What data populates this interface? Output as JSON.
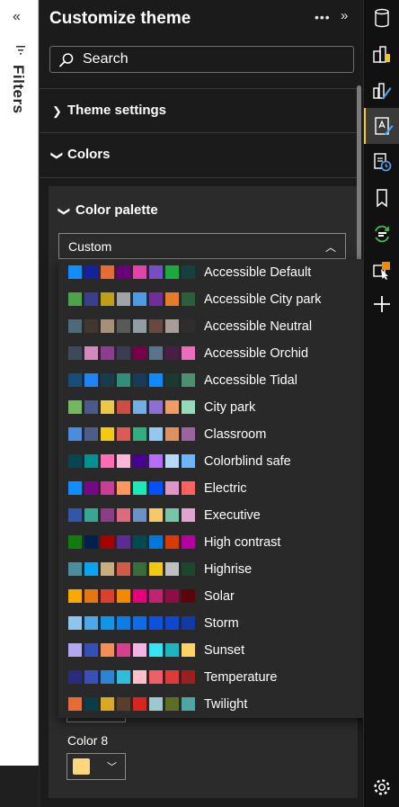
{
  "filters": {
    "label": "Filters"
  },
  "pane": {
    "title": "Customize theme",
    "search_placeholder": "Search",
    "sections": [
      "Theme settings",
      "Colors"
    ],
    "palette_title": "Color palette",
    "dropdown_value": "Custom",
    "color8_label": "Color 8",
    "color8_value": "#fdd77b"
  },
  "palette_options": [
    {
      "name": "Accessible Default",
      "colors": [
        "#118dff",
        "#12239e",
        "#e66c37",
        "#6b007b",
        "#e044a7",
        "#744ec2",
        "#1aab40",
        "#15403e"
      ]
    },
    {
      "name": "Accessible City park",
      "colors": [
        "#4da34b",
        "#393f8a",
        "#c09e16",
        "#a0a3a8",
        "#4e9ae3",
        "#6e2f98",
        "#e57c27",
        "#2c5e3a"
      ]
    },
    {
      "name": "Accessible Neutral",
      "colors": [
        "#4c6b76",
        "#43362f",
        "#a79078",
        "#595959",
        "#929ca3",
        "#67493f",
        "#a59d96",
        "#2e2e2e"
      ]
    },
    {
      "name": "Accessible Orchid",
      "colors": [
        "#3c4b5c",
        "#d389bd",
        "#8c3d8e",
        "#3b3b54",
        "#780048",
        "#5a748e",
        "#4a1e43",
        "#ec6dbe"
      ]
    },
    {
      "name": "Accessible Tidal",
      "colors": [
        "#184d7a",
        "#1f84f6",
        "#1a3b4a",
        "#328d7a",
        "#1a3a5a",
        "#0e8afe",
        "#1a3a30",
        "#4d8f6e"
      ]
    },
    {
      "name": "City park",
      "colors": [
        "#73b761",
        "#4a588a",
        "#ecc846",
        "#cd4c46",
        "#71afe2",
        "#8d6fd1",
        "#ee9e64",
        "#95dabb"
      ]
    },
    {
      "name": "Classroom",
      "colors": [
        "#4a8ddc",
        "#4c5d8a",
        "#f3c911",
        "#dc5b57",
        "#33ae81",
        "#95c8f0",
        "#dd915f",
        "#9a64a0"
      ]
    },
    {
      "name": "Colorblind safe",
      "colors": [
        "#074650",
        "#009292",
        "#fe6db6",
        "#feb5da",
        "#480091",
        "#b66dff",
        "#b5dafe",
        "#6db6ff"
      ]
    },
    {
      "name": "Electric",
      "colors": [
        "#118dff",
        "#750985",
        "#c83d95",
        "#ff985e",
        "#1de9b6",
        "#0051ff",
        "#dc97c6",
        "#fd625e"
      ]
    },
    {
      "name": "Executive",
      "colors": [
        "#3257a8",
        "#37a794",
        "#8b3d88",
        "#dd6b7f",
        "#6b91c9",
        "#f5c869",
        "#77c4a8",
        "#dea6cf"
      ]
    },
    {
      "name": "High contrast",
      "colors": [
        "#107c10",
        "#002050",
        "#a80000",
        "#5c2d91",
        "#004b50",
        "#0078d7",
        "#d83b01",
        "#b4009e"
      ]
    },
    {
      "name": "Highrise",
      "colors": [
        "#4c8d9d",
        "#0ba4f0",
        "#c8ad7f",
        "#d05b4a",
        "#386d3a",
        "#f2c811",
        "#bfbfbf",
        "#1d462c"
      ]
    },
    {
      "name": "Solar",
      "colors": [
        "#f9a800",
        "#e57712",
        "#db3f2d",
        "#f28a00",
        "#e6007a",
        "#c02370",
        "#8e0d44",
        "#5a0608"
      ]
    },
    {
      "name": "Storm",
      "colors": [
        "#8fc4ec",
        "#4ea8e8",
        "#0f96e8",
        "#0d7de6",
        "#0f6be6",
        "#0c52dd",
        "#0f47d0",
        "#123aa5"
      ]
    },
    {
      "name": "Sunset",
      "colors": [
        "#b3a8ef",
        "#3550b4",
        "#f38f56",
        "#d5408f",
        "#f4b3e3",
        "#35e5f5",
        "#1bb6c2",
        "#ffd264"
      ]
    },
    {
      "name": "Temperature",
      "colors": [
        "#2a2c7b",
        "#3b4fb5",
        "#2d84d2",
        "#31bcd9",
        "#ffbfc7",
        "#f05f68",
        "#dd3a3a",
        "#9a1f1f"
      ]
    },
    {
      "name": "Twilight",
      "colors": [
        "#e66c37",
        "#0a3d4a",
        "#d9a926",
        "#5a3d2b",
        "#d8251f",
        "#9fc7d0",
        "#5c6e23",
        "#4fa6a6"
      ]
    }
  ],
  "rail_icons": [
    "data-icon",
    "build-visual-icon",
    "format-visual-icon",
    "customize-theme-icon",
    "performance-icon",
    "bookmark-icon",
    "sync-slicers-icon",
    "selection-icon",
    "add-icon",
    "settings-icon"
  ],
  "colors": {
    "accent": "#f2c811"
  }
}
